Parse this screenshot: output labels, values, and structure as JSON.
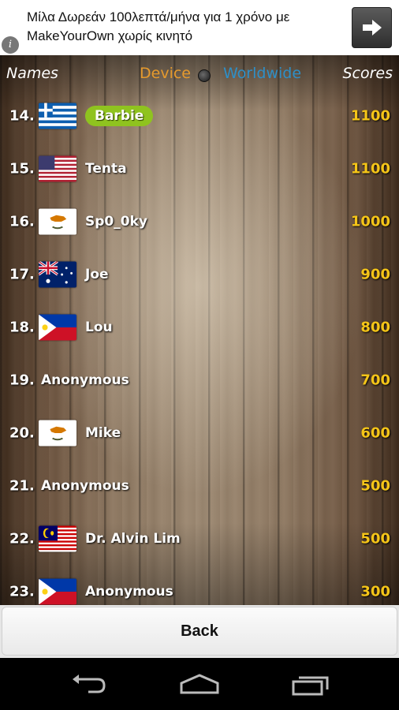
{
  "ad": {
    "text": "Μίλα Δωρεάν 100λεπτά/μήνα για 1 χρόνο με MakeYourOwn χωρίς κινητό",
    "info_icon": "info-icon",
    "arrow_icon": "arrow-right-icon"
  },
  "header": {
    "names": "Names",
    "device": "Device",
    "worldwide": "Worldwide",
    "scores": "Scores"
  },
  "colors": {
    "device_tab": "#e69a2d",
    "worldwide_tab": "#2e8fc7",
    "score": "#f5c518",
    "highlight": "#8fc31f"
  },
  "rows": [
    {
      "rank": "14.",
      "flag": "greece-flag",
      "name": "Barbie",
      "score": "1100"
    },
    {
      "rank": "15.",
      "flag": "usa-flag",
      "name": "Tenta",
      "score": "1100"
    },
    {
      "rank": "16.",
      "flag": "cyprus-flag",
      "name": "Sp0_0ky",
      "score": "1000"
    },
    {
      "rank": "17.",
      "flag": "australia-flag",
      "name": "Joe",
      "score": "900"
    },
    {
      "rank": "18.",
      "flag": "philippines-flag",
      "name": "Lou",
      "score": "800"
    },
    {
      "rank": "19.",
      "flag": "",
      "name": "Anonymous",
      "score": "700"
    },
    {
      "rank": "20.",
      "flag": "cyprus-flag",
      "name": "Mike",
      "score": "600"
    },
    {
      "rank": "21.",
      "flag": "",
      "name": "Anonymous",
      "score": "500"
    },
    {
      "rank": "22.",
      "flag": "malaysia-flag",
      "name": "Dr. Alvin Lim",
      "score": "500"
    },
    {
      "rank": "23.",
      "flag": "philippines-flag",
      "name": "Anonymous",
      "score": "300"
    }
  ],
  "back": {
    "label": "Back"
  },
  "navbar": {
    "icons": [
      "back-icon",
      "home-icon",
      "recent-apps-icon"
    ]
  }
}
